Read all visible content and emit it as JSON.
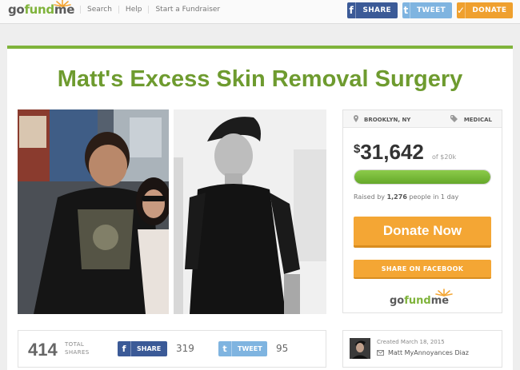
{
  "header": {
    "logo": {
      "go": "go",
      "fund": "fund",
      "me": "me"
    },
    "nav": [
      "Search",
      "Help",
      "Start a Fundraiser"
    ],
    "share_label": "SHARE",
    "tweet_label": "TWEET",
    "donate_label": "DONATE"
  },
  "campaign": {
    "title": "Matt's Excess Skin Removal Surgery",
    "location": "BROOKLYN, NY",
    "category": "MEDICAL",
    "amount": "31,642",
    "currency": "$",
    "goal": "of $20k",
    "progress": 1.0,
    "raised_prefix": "Raised by ",
    "raised_count": "1,276",
    "raised_suffix": " people in 1 day",
    "donate_label": "Donate Now",
    "share_fb_label": "SHARE ON FACEBOOK"
  },
  "share_strip": {
    "total": "414",
    "total_label_1": "TOTAL",
    "total_label_2": "SHARES",
    "share_label": "SHARE",
    "share_count": "319",
    "tweet_label": "TWEET",
    "tweet_count": "95"
  },
  "creator": {
    "created": "Created March 18, 2015",
    "name": "Matt MyAnnoyances Diaz"
  },
  "colors": {
    "brand_green": "#7fb33b",
    "title_green": "#6e9b2f",
    "facebook": "#3b5a97",
    "twitter": "#7fb4e0",
    "orange": "#f4a634"
  }
}
